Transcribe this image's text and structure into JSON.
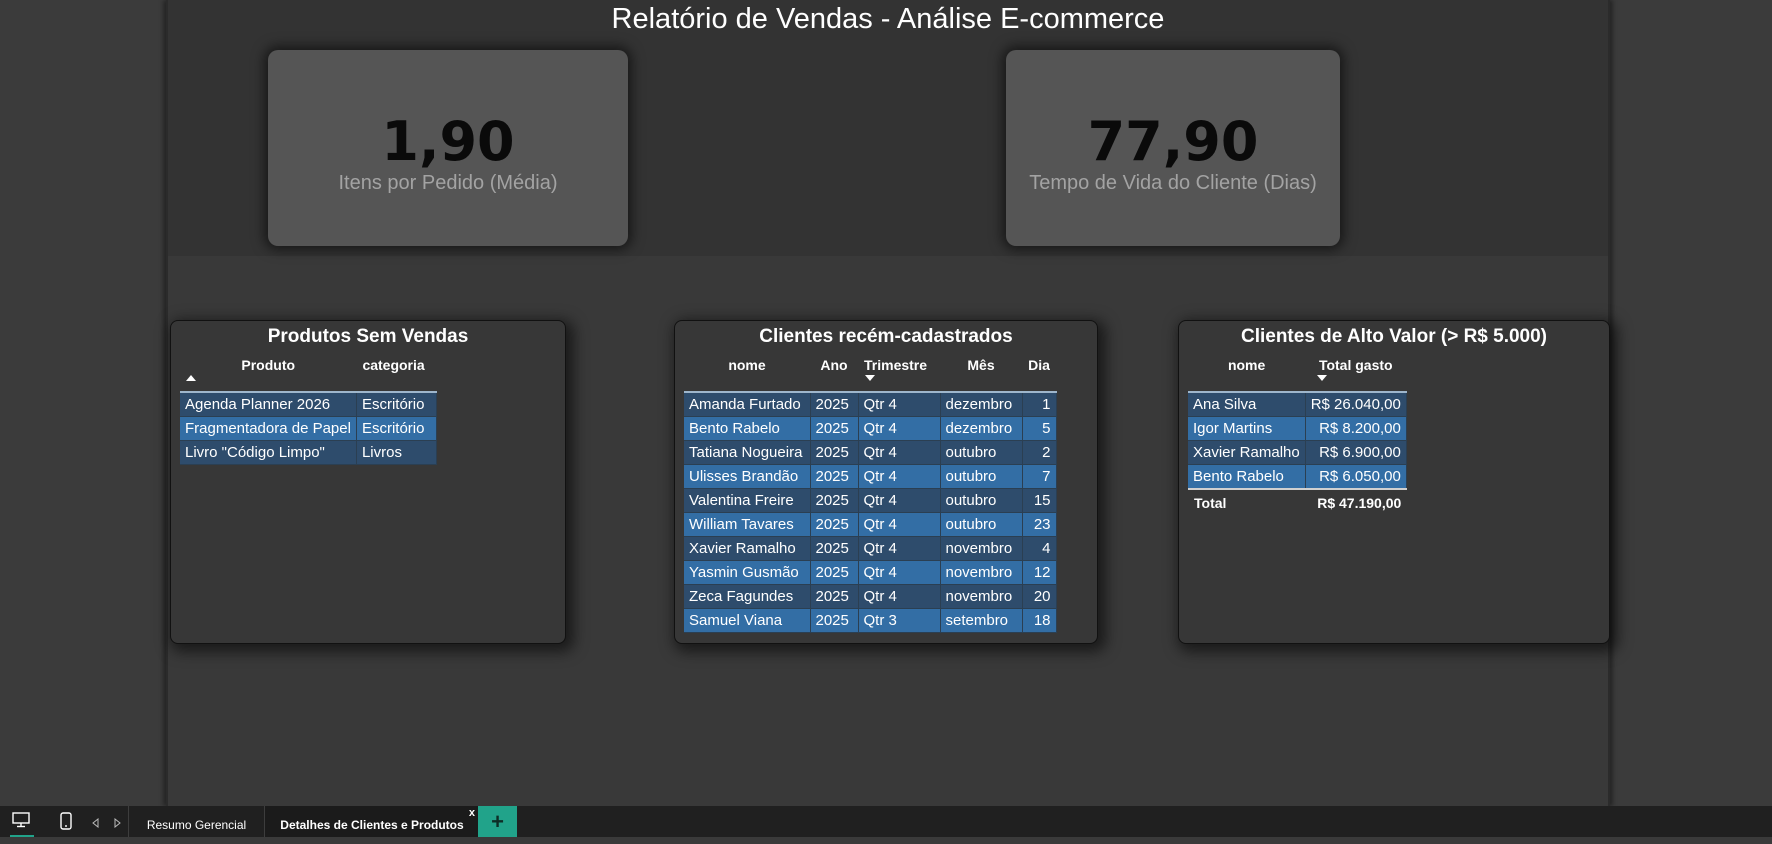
{
  "report": {
    "title": "Relatório de Vendas - Análise E-commerce"
  },
  "kpis": [
    {
      "value": "1,90",
      "label": "Itens por Pedido (Média)"
    },
    {
      "value": "77,90",
      "label": "Tempo de Vida do Cliente (Dias)"
    }
  ],
  "produtos_sem_vendas": {
    "title": "Produtos Sem Vendas",
    "columns": [
      "Produto",
      "categoria"
    ],
    "rows": [
      [
        "Agenda Planner 2026",
        "Escritório"
      ],
      [
        "Fragmentadora de Papel",
        "Escritório"
      ],
      [
        "Livro \"Código Limpo\"",
        "Livros"
      ]
    ]
  },
  "clientes_recentes": {
    "title": "Clientes recém-cadastrados",
    "columns": [
      "nome",
      "Ano",
      "Trimestre",
      "Mês",
      "Dia"
    ],
    "rows": [
      [
        "Amanda Furtado",
        "2025",
        "Qtr 4",
        "dezembro",
        "1"
      ],
      [
        "Bento Rabelo",
        "2025",
        "Qtr 4",
        "dezembro",
        "5"
      ],
      [
        "Tatiana Nogueira",
        "2025",
        "Qtr 4",
        "outubro",
        "2"
      ],
      [
        "Ulisses Brandão",
        "2025",
        "Qtr 4",
        "outubro",
        "7"
      ],
      [
        "Valentina Freire",
        "2025",
        "Qtr 4",
        "outubro",
        "15"
      ],
      [
        "William Tavares",
        "2025",
        "Qtr 4",
        "outubro",
        "23"
      ],
      [
        "Xavier Ramalho",
        "2025",
        "Qtr 4",
        "novembro",
        "4"
      ],
      [
        "Yasmin Gusmão",
        "2025",
        "Qtr 4",
        "novembro",
        "12"
      ],
      [
        "Zeca Fagundes",
        "2025",
        "Qtr 4",
        "novembro",
        "20"
      ],
      [
        "Samuel Viana",
        "2025",
        "Qtr 3",
        "setembro",
        "18"
      ]
    ]
  },
  "clientes_alto_valor": {
    "title": "Clientes de Alto Valor (> R$ 5.000)",
    "columns": [
      "nome",
      "Total gasto"
    ],
    "rows": [
      [
        "Ana Silva",
        "R$ 26.040,00"
      ],
      [
        "Igor Martins",
        "R$ 8.200,00"
      ],
      [
        "Xavier Ramalho",
        "R$ 6.900,00"
      ],
      [
        "Bento Rabelo",
        "R$ 6.050,00"
      ]
    ],
    "total_label": "Total",
    "total_value": "R$ 47.190,00"
  },
  "taskbar": {
    "tabs": [
      "Resumo Gerencial",
      "Detalhes de Clientes e Produtos"
    ],
    "active_tab": "Detalhes de Clientes e Produtos",
    "close_label": "x",
    "add_label": "+",
    "accent": "#21a38a"
  },
  "colors": {
    "row_dark": "#2e4c6c",
    "row_light": "#336ea5",
    "kpi_bg": "#555555"
  }
}
